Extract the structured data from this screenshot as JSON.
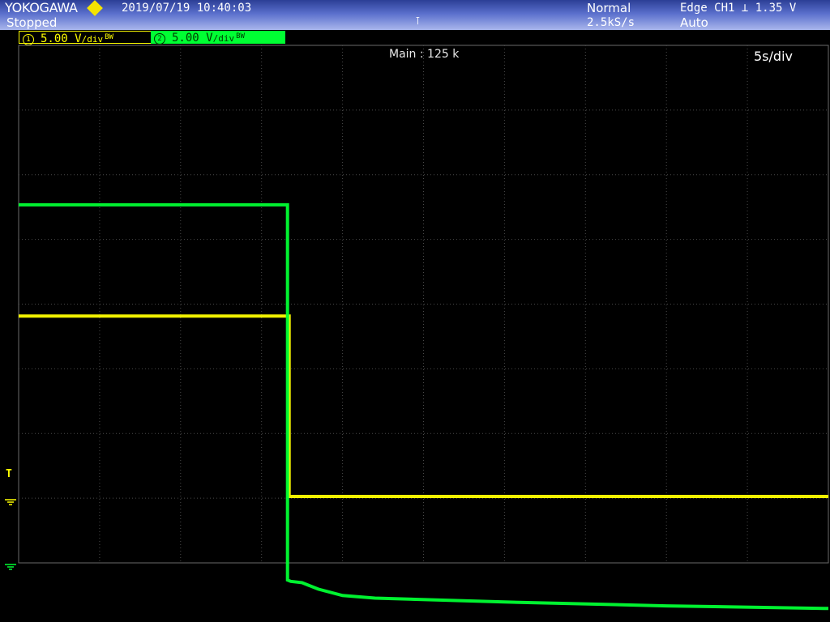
{
  "header": {
    "brand": "YOKOGAWA",
    "status": "Stopped",
    "datetime": "2019/07/19 10:40:03",
    "acquisition_mode": "Normal",
    "sample_rate": "2.5kS/s",
    "trigger_type": "Edge CH1",
    "trigger_slope_icon": "falling-edge-icon",
    "trigger_level": "1.35 V",
    "trigger_mode": "Auto"
  },
  "channels": [
    {
      "number": "1",
      "scale": "5.00 V",
      "unit": "/div",
      "color": "#ffff00"
    },
    {
      "number": "2",
      "scale": "5.00 V",
      "unit": "/div",
      "color": "#00ff33"
    }
  ],
  "bandwidth_icon": "BW",
  "plot": {
    "record_length": "Main : 125 k",
    "timebase": "5s/div",
    "trigger_level_marker": "T",
    "divisions_x": 10,
    "divisions_y": 8
  },
  "colors": {
    "header_top": "#2c3f96",
    "header_bottom": "#a9b6ec",
    "ch1": "#ffff00",
    "ch2": "#00ff33",
    "grid": "#4a4a4a",
    "background": "#000000"
  },
  "chart_data": {
    "type": "line",
    "xlabel": "",
    "ylabel": "",
    "x_unit": "s",
    "y_unit": "V",
    "xlim": [
      0,
      50
    ],
    "series": [
      {
        "name": "CH1",
        "color": "#ffff00",
        "x": [
          0,
          16.7,
          16.7,
          50
        ],
        "y": [
          14.2,
          14.2,
          0.25,
          0.25
        ]
      },
      {
        "name": "CH2",
        "color": "#00ff33",
        "x": [
          0,
          16.6,
          16.6,
          16.8,
          17.5,
          18.5,
          20,
          22,
          30,
          40,
          50
        ],
        "y": [
          27.8,
          27.8,
          -1.2,
          -1.3,
          -1.4,
          -1.9,
          -2.4,
          -2.6,
          -2.9,
          -3.2,
          -3.4
        ]
      }
    ]
  }
}
